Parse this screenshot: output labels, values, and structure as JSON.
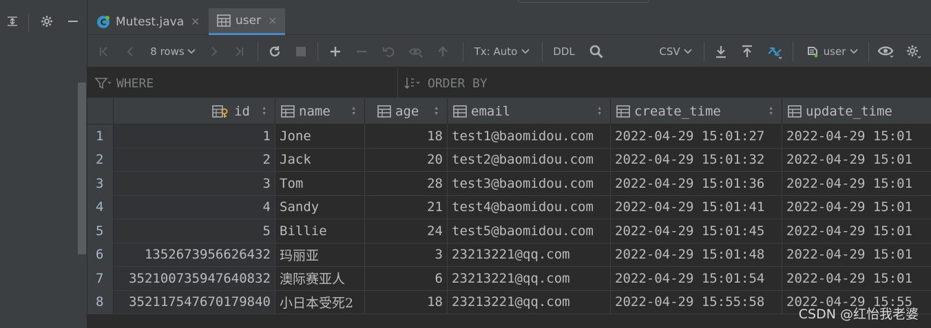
{
  "tabs": [
    {
      "label": "Mutest.java",
      "icon": "java-class-icon",
      "active": false
    },
    {
      "label": "user",
      "icon": "table-icon",
      "active": true
    }
  ],
  "toolbar": {
    "rows_label": "8 rows",
    "tx_label": "Tx: Auto",
    "ddl_label": "DDL",
    "format_label": "CSV",
    "datasource_label": "user"
  },
  "filter": {
    "where_label": "WHERE",
    "order_label": "ORDER BY"
  },
  "columns": [
    "id",
    "name",
    "age",
    "email",
    "create_time",
    "update_time"
  ],
  "rows": [
    {
      "n": "1",
      "id": "1",
      "name": "Jone",
      "age": "18",
      "email": "test1@baomidou.com",
      "create_time": "2022-04-29 15:01:27",
      "update_time": "2022-04-29 15:01"
    },
    {
      "n": "2",
      "id": "2",
      "name": "Jack",
      "age": "20",
      "email": "test2@baomidou.com",
      "create_time": "2022-04-29 15:01:32",
      "update_time": "2022-04-29 15:01"
    },
    {
      "n": "3",
      "id": "3",
      "name": "Tom",
      "age": "28",
      "email": "test3@baomidou.com",
      "create_time": "2022-04-29 15:01:36",
      "update_time": "2022-04-29 15:01"
    },
    {
      "n": "4",
      "id": "4",
      "name": "Sandy",
      "age": "21",
      "email": "test4@baomidou.com",
      "create_time": "2022-04-29 15:01:41",
      "update_time": "2022-04-29 15:01"
    },
    {
      "n": "5",
      "id": "5",
      "name": "Billie",
      "age": "24",
      "email": "test5@baomidou.com",
      "create_time": "2022-04-29 15:01:45",
      "update_time": "2022-04-29 15:01"
    },
    {
      "n": "6",
      "id": "1352673956626432",
      "name": "玛丽亚",
      "age": "3",
      "email": "23213221@qq.com",
      "create_time": "2022-04-29 15:01:48",
      "update_time": "2022-04-29 15:01"
    },
    {
      "n": "7",
      "id": "352100735947640832",
      "name": "澳际赛亚人",
      "age": "6",
      "email": "23213221@qq.com",
      "create_time": "2022-04-29 15:01:54",
      "update_time": "2022-04-29 15:01"
    },
    {
      "n": "8",
      "id": "352117547670179840",
      "name": "小日本受死2",
      "age": "18",
      "email": "23213221@qq.com",
      "create_time": "2022-04-29 15:55:58",
      "update_time": "2022-04-29 15:55"
    }
  ],
  "watermark": "CSDN @红怡我老婆",
  "colors": {
    "accent": "#4a88c7",
    "background": "#2b2b2b",
    "panel": "#3c3f41",
    "text": "#bbbbbb"
  }
}
